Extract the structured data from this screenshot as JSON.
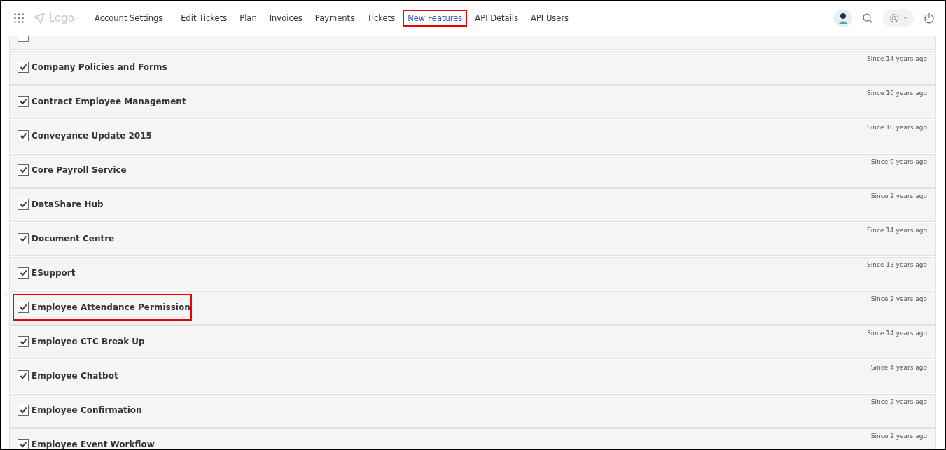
{
  "header": {
    "logo": "Logo",
    "nav": [
      {
        "label": "Account Settings",
        "selected": false,
        "highlighted": false
      },
      {
        "label": "Edit Tickets",
        "selected": false,
        "highlighted": false
      },
      {
        "label": "Plan",
        "selected": false,
        "highlighted": false
      },
      {
        "label": "Invoices",
        "selected": false,
        "highlighted": false
      },
      {
        "label": "Payments",
        "selected": false,
        "highlighted": false
      },
      {
        "label": "Tickets",
        "selected": false,
        "highlighted": false
      },
      {
        "label": "New Features",
        "selected": true,
        "highlighted": true
      },
      {
        "label": "API Details",
        "selected": false,
        "highlighted": false
      },
      {
        "label": "API Users",
        "selected": false,
        "highlighted": false
      }
    ]
  },
  "features": [
    {
      "name": "Company Policies and Forms",
      "checked": true,
      "since": "Since 14 years ago",
      "highlighted": false
    },
    {
      "name": "Contract Employee Management",
      "checked": true,
      "since": "Since 10 years ago",
      "highlighted": false
    },
    {
      "name": "Conveyance Update 2015",
      "checked": true,
      "since": "Since 10 years ago",
      "highlighted": false
    },
    {
      "name": "Core Payroll Service",
      "checked": true,
      "since": "Since 9 years ago",
      "highlighted": false
    },
    {
      "name": "DataShare Hub",
      "checked": true,
      "since": "Since 2 years ago",
      "highlighted": false
    },
    {
      "name": "Document Centre",
      "checked": true,
      "since": "Since 14 years ago",
      "highlighted": false
    },
    {
      "name": "ESupport",
      "checked": true,
      "since": "Since 13 years ago",
      "highlighted": false
    },
    {
      "name": "Employee Attendance Permission",
      "checked": true,
      "since": "Since 2 years ago",
      "highlighted": true
    },
    {
      "name": "Employee CTC Break Up",
      "checked": true,
      "since": "Since 14 years ago",
      "highlighted": false
    },
    {
      "name": "Employee Chatbot",
      "checked": true,
      "since": "Since 4 years ago",
      "highlighted": false
    },
    {
      "name": "Employee Confirmation",
      "checked": true,
      "since": "Since 2 years ago",
      "highlighted": false
    },
    {
      "name": "Employee Event Workflow",
      "checked": true,
      "since": "Since 2 years ago",
      "highlighted": false
    }
  ]
}
